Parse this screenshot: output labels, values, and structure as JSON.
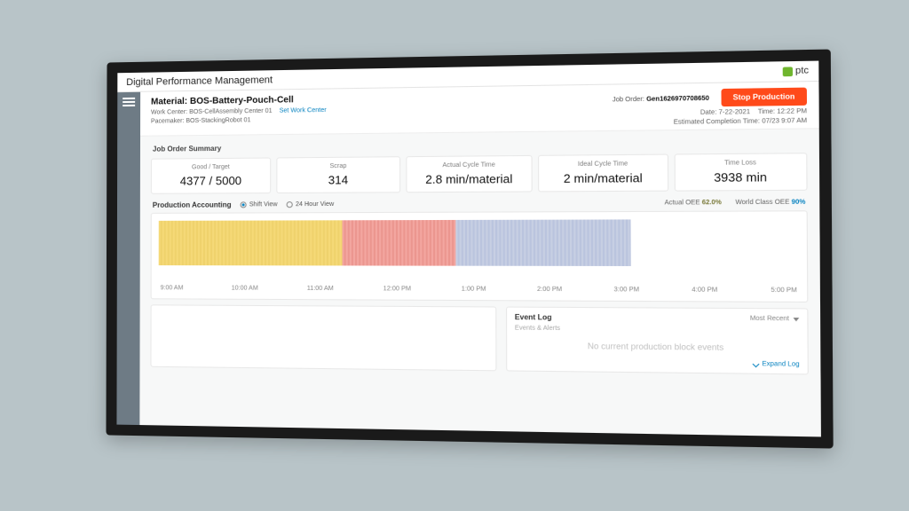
{
  "titlebar": {
    "title": "Digital Performance Management",
    "brand": "ptc"
  },
  "header": {
    "material_label": "Material:",
    "material_value": "BOS-Battery-Pouch-Cell",
    "workcenter_label": "Work Center:",
    "workcenter_value": "BOS-CellAssembly Center 01",
    "set_work_center": "Set Work Center",
    "pacemaker_label": "Pacemaker:",
    "pacemaker_value": "BOS-StackingRobot 01",
    "joborder_label": "Job Order:",
    "joborder_value": "Gen1626970708650",
    "stop_button": "Stop Production",
    "date_label": "Date:",
    "date_value": "7-22-2021",
    "time_label": "Time:",
    "time_value": "12:22 PM",
    "eta_label": "Estimated Completion Time:",
    "eta_value": "07/23 9:07 AM"
  },
  "summary": {
    "section": "Job Order Summary",
    "cards": [
      {
        "label": "Good / Target",
        "value": "4377 / 5000"
      },
      {
        "label": "Scrap",
        "value": "314"
      },
      {
        "label": "Actual Cycle Time",
        "value": "2.8 min/material"
      },
      {
        "label": "Ideal Cycle Time",
        "value": "2 min/material"
      },
      {
        "label": "Time Loss",
        "value": "3938 min"
      }
    ]
  },
  "pa": {
    "title": "Production Accounting",
    "shift_view": "Shift View",
    "day_view": "24 Hour View",
    "actual_oee_label": "Actual OEE",
    "actual_oee_value": "62.0%",
    "world_class_label": "World Class OEE",
    "world_class_value": "90%"
  },
  "timeline": {
    "ticks": [
      "9:00 AM",
      "10:00 AM",
      "11:00 AM",
      "12:00 PM",
      "1:00 PM",
      "2:00 PM",
      "3:00 PM",
      "4:00 PM",
      "5:00 PM"
    ]
  },
  "eventlog": {
    "title": "Event Log",
    "sort": "Most Recent",
    "sub": "Events & Alerts",
    "empty": "No current production block events",
    "expand": "Expand Log"
  }
}
